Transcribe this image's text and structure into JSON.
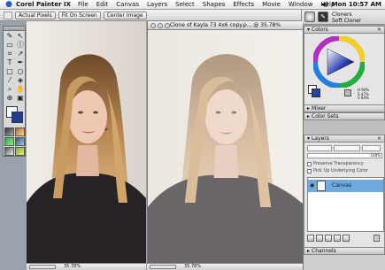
{
  "menubar": {
    "app_name": "Corel Painter IX",
    "menus": [
      "File",
      "Edit",
      "Canvas",
      "Layers",
      "Select",
      "Shapes",
      "Effects",
      "Movie",
      "Window",
      "Help"
    ],
    "clock": "Mon 10:57 AM"
  },
  "property_bar": {
    "buttons": [
      "Actual Pixels",
      "Fit On Screen",
      "Center Image"
    ]
  },
  "brush_selector": {
    "category": "Cloners",
    "variant": "Soft Cloner"
  },
  "documents": {
    "right_title": "Clone of Kayla 73 4x6 copy.p... @ 35.78%",
    "left_zoom": "35.78%",
    "right_zoom": "35.78%"
  },
  "palettes": {
    "colors_title": "Colors",
    "hsv_h": "H 90%",
    "hsv_s": "S 47%",
    "hsv_v": "V 84%",
    "mixer_title": "Mixer",
    "color_sets_title": "Color Sets",
    "layers_title": "Layers",
    "opacity": "100%",
    "preserve_transparency": "Preserve Transparency",
    "pick_up_underlying": "Pick Up Underlying Color",
    "layer_name": "Canvas",
    "channels_title": "Channels"
  },
  "colors": {
    "primary": "#ffffff",
    "secondary": "#1f3f95",
    "layer_selected": "#6fa9de"
  }
}
